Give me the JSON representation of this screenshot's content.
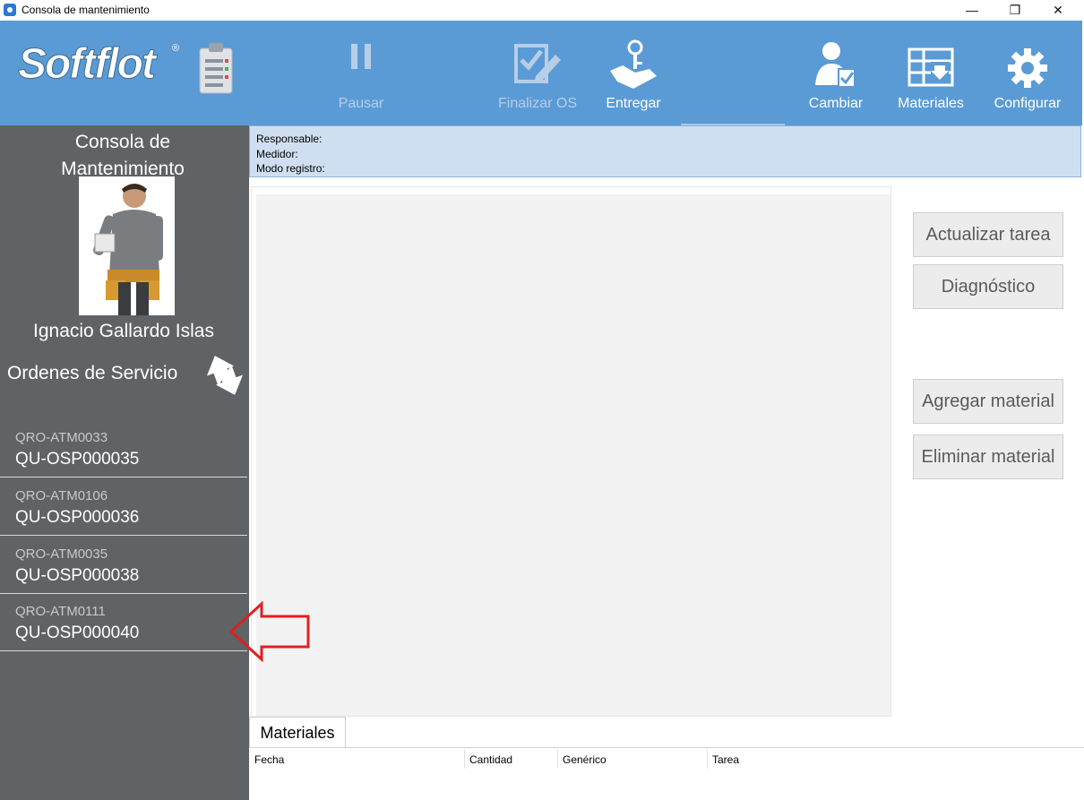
{
  "window": {
    "title": "Consola de mantenimiento",
    "controls": {
      "minimize": "—",
      "restore": "❐",
      "close": "✕"
    }
  },
  "brand": {
    "logo_text": "Softflot",
    "reg": "®"
  },
  "toolbar": {
    "pause": "Pausar",
    "finish": "Finalizar OS",
    "deliver": "Entregar",
    "change": "Cambiar",
    "materials": "Materiales",
    "configure": "Configurar"
  },
  "info": {
    "responsable": "Responsable:",
    "medidor": "Medidor:",
    "modo": "Modo registro:"
  },
  "sidebar": {
    "title_line1": "Consola de",
    "title_line2": "Mantenimiento",
    "user_name": "Ignacio Gallardo Islas",
    "orders_title": "Ordenes de Servicio",
    "orders": [
      {
        "code": "QRO-ATM0033",
        "number": "QU-OSP000035"
      },
      {
        "code": "QRO-ATM0106",
        "number": "QU-OSP000036"
      },
      {
        "code": "QRO-ATM0035",
        "number": "QU-OSP000038"
      },
      {
        "code": "QRO-ATM0111",
        "number": "QU-OSP000040"
      }
    ]
  },
  "actions": {
    "update_task": "Actualizar tarea",
    "diagnostic": "Diagnóstico",
    "add_material": "Agregar material",
    "remove_material": "Eliminar material"
  },
  "materials_tab": {
    "tab_label": "Materiales",
    "columns": [
      "Fecha",
      "Cantidad",
      "Genérico",
      "Tarea"
    ]
  },
  "colors": {
    "toolbar": "#5b9bd5",
    "sidebar": "#5f6366",
    "infobar": "#cfdff1",
    "annotation_arrow": "#e02020"
  }
}
